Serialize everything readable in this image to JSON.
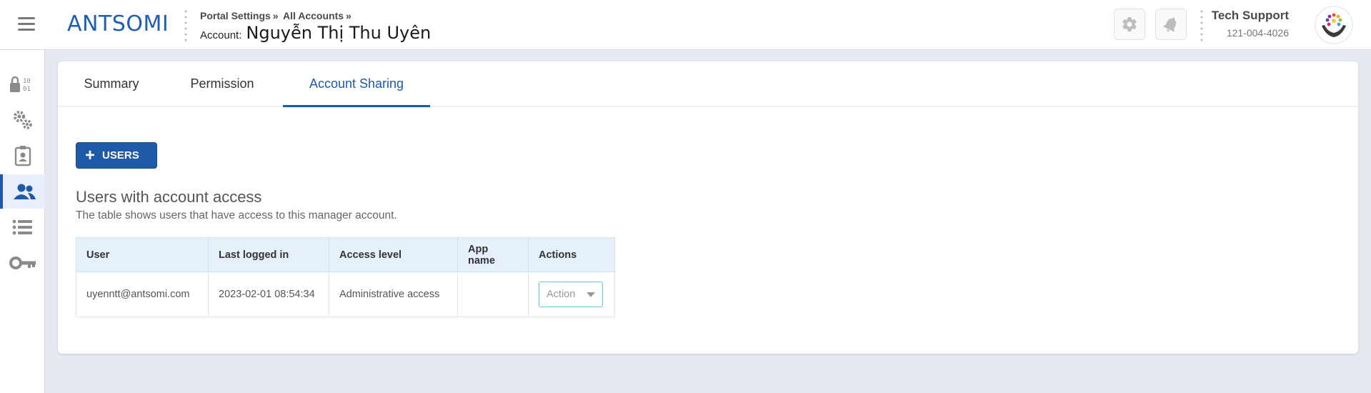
{
  "brand": {
    "logo_text": "ANTSOMI"
  },
  "header": {
    "breadcrumb": [
      "Portal Settings",
      "All Accounts"
    ],
    "breadcrumb_sep": "»",
    "account_label": "Account:",
    "account_name": "Nguyễn Thị Thu Uyên"
  },
  "user": {
    "name": "Tech Support",
    "phone": "121-004-4026"
  },
  "tabs": [
    {
      "label": "Summary",
      "active": false
    },
    {
      "label": "Permission",
      "active": false
    },
    {
      "label": "Account Sharing",
      "active": true
    }
  ],
  "add_button_label": "USERS",
  "section": {
    "title": "Users with account access",
    "description": "The table shows users that have access to this manager account."
  },
  "table": {
    "columns": [
      "User",
      "Last logged in",
      "Access level",
      "App name",
      "Actions"
    ],
    "rows": [
      {
        "user": "uyenntt@antsomi.com",
        "last_logged_in": "2023-02-01 08:54:34",
        "access_level": "Administrative access",
        "app_name": "",
        "action_placeholder": "Action"
      }
    ]
  },
  "colors": {
    "primary": "#1f5aa8",
    "table_header_bg": "#e6f0fa",
    "page_bg": "#e6e8f2"
  },
  "rail_icons": [
    "lock-binary-icon",
    "gears-icon",
    "badge-icon",
    "users-icon",
    "list-icon",
    "key-icon"
  ]
}
